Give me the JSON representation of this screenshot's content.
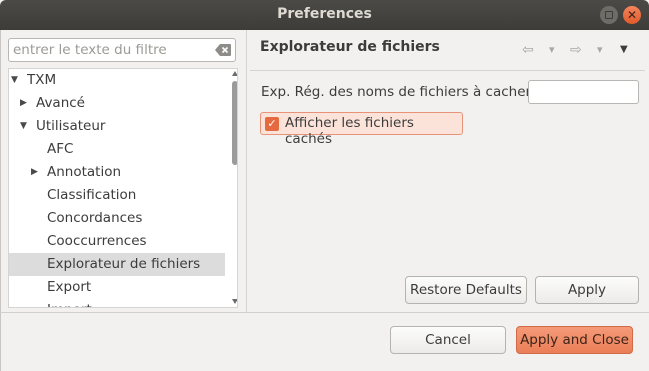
{
  "window": {
    "title": "Preferences",
    "close_glyph": "✕"
  },
  "filter": {
    "placeholder": "entrer le texte du filtre",
    "value": ""
  },
  "tree": {
    "items": [
      {
        "label": "TXM",
        "expanded": true
      },
      {
        "label": "Avancé",
        "expanded": false
      },
      {
        "label": "Utilisateur",
        "expanded": true
      },
      {
        "label": "AFC"
      },
      {
        "label": "Annotation",
        "expanded": false
      },
      {
        "label": "Classification"
      },
      {
        "label": "Concordances"
      },
      {
        "label": "Cooccurrences"
      },
      {
        "label": "Explorateur de fichiers",
        "selected": true
      },
      {
        "label": "Export"
      },
      {
        "label": "Import"
      }
    ]
  },
  "page": {
    "title": "Explorateur de fichiers",
    "nav": {
      "back_glyph": "⇦",
      "back_menu_glyph": "▾",
      "forward_glyph": "⇨",
      "forward_menu_glyph": "▾",
      "view_menu_glyph": "▼"
    },
    "field_label": "Exp. Rég. des noms de fichiers à cacher",
    "field_value": "",
    "checkbox_label": "Afficher les fichiers cachés",
    "checkbox_checked": true,
    "checkbox_glyph": "✓",
    "restore_defaults": "Restore Defaults",
    "apply": "Apply"
  },
  "footer": {
    "cancel": "Cancel",
    "apply_and_close": "Apply and Close"
  },
  "colors": {
    "accent": "#ea7e57",
    "titlebar": "#3d3c39",
    "selection": "#dcdcdc"
  }
}
